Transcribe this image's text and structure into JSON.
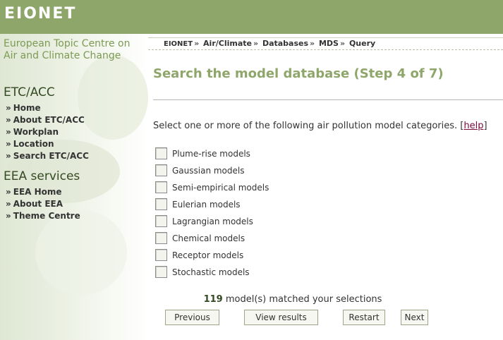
{
  "header": {
    "logo": "EIONET"
  },
  "sidebar": {
    "centre_name": "European Topic Centre on Air and Climate Change",
    "section1": {
      "title": "ETC/ACC",
      "items": [
        "Home",
        "About ETC/ACC",
        "Workplan",
        "Location",
        "Search ETC/ACC"
      ]
    },
    "section2": {
      "title": "EEA services",
      "items": [
        "EEA Home",
        "About EEA",
        "Theme Centre"
      ]
    },
    "bullet": "»"
  },
  "breadcrumb": {
    "items": [
      "EIONET",
      "Air/Climate",
      "Databases",
      "MDS",
      "Query"
    ],
    "separator": "»"
  },
  "main": {
    "title": "Search the model database (Step 4 of 7)",
    "instruction": "Select one or more of the following air pollution model categories.",
    "help_open": "[",
    "help_label": "help",
    "help_close": "]",
    "categories": [
      "Plume-rise models",
      "Gaussian models",
      "Semi-empirical models",
      "Eulerian models",
      "Lagrangian models",
      "Chemical models",
      "Receptor models",
      "Stochastic models"
    ],
    "match_count": "119",
    "match_text": "model(s) matched your selections"
  },
  "buttons": {
    "previous": "Previous",
    "view_results": "View results",
    "restart": "Restart",
    "next": "Next"
  },
  "colors": {
    "header_bg": "#8fa66b",
    "title": "#8fa66b",
    "link": "#7a0a3c"
  }
}
